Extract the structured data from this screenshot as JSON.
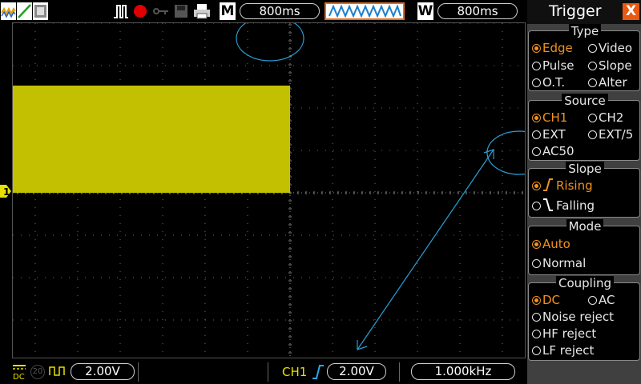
{
  "topbar": {
    "mode_label": "M",
    "time_base": "800ms",
    "window_label": "W",
    "window_time": "800ms"
  },
  "bottombar": {
    "ch1_scale": "2.00V",
    "ch1_label": "CH1",
    "trigger_level": "2.00V",
    "frequency": "1.000kHz",
    "ch2_number": "20"
  },
  "channel_marker": "1",
  "menu": {
    "title": "Trigger",
    "close": "X",
    "type": {
      "heading": "Type",
      "options": [
        {
          "label": "Edge",
          "selected": true
        },
        {
          "label": "Video",
          "selected": false
        },
        {
          "label": "Pulse",
          "selected": false
        },
        {
          "label": "Slope",
          "selected": false
        },
        {
          "label": "O.T.",
          "selected": false
        },
        {
          "label": "Alter",
          "selected": false
        }
      ]
    },
    "source": {
      "heading": "Source",
      "options": [
        {
          "label": "CH1",
          "selected": true
        },
        {
          "label": "CH2",
          "selected": false
        },
        {
          "label": "EXT",
          "selected": false
        },
        {
          "label": "EXT/5",
          "selected": false
        },
        {
          "label": "AC50",
          "selected": false
        }
      ]
    },
    "slope": {
      "heading": "Slope",
      "options": [
        {
          "label": "Rising",
          "selected": true
        },
        {
          "label": "Falling",
          "selected": false
        }
      ]
    },
    "mode": {
      "heading": "Mode",
      "options": [
        {
          "label": "Auto",
          "selected": true
        },
        {
          "label": "Normal",
          "selected": false
        }
      ]
    },
    "coupling": {
      "heading": "Coupling",
      "options": [
        {
          "label": "DC",
          "selected": true
        },
        {
          "label": "AC",
          "selected": false
        },
        {
          "label": "Noise reject",
          "selected": false
        },
        {
          "label": "HF reject",
          "selected": false
        },
        {
          "label": "LF reject",
          "selected": false
        }
      ]
    }
  },
  "colors": {
    "ch1": "#c2c000",
    "selected_option": "#f0921e",
    "annotation": "#2a9fd6",
    "close_button": "#e85a10"
  }
}
